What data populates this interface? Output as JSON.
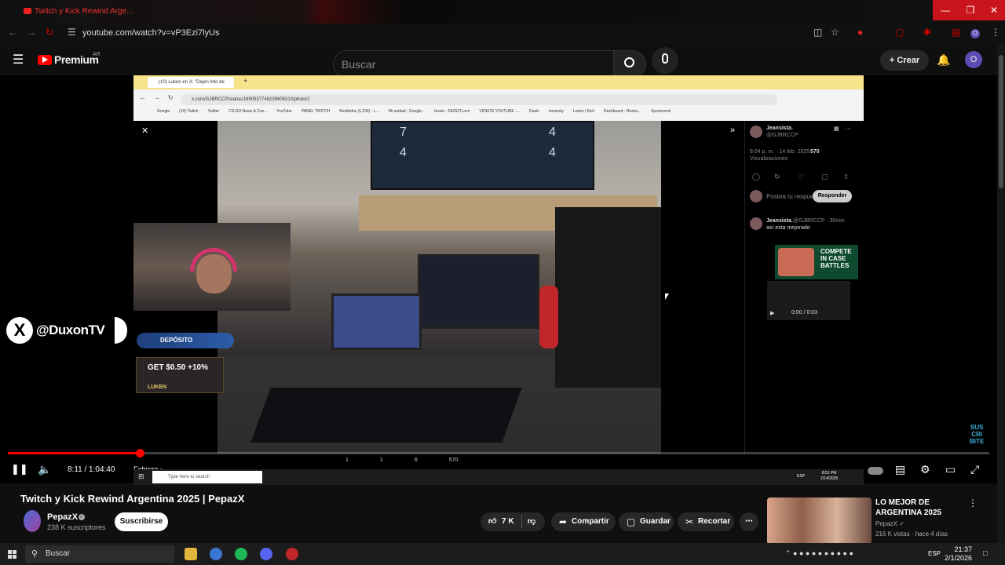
{
  "browser": {
    "tab_title": "Twitch y Kick Rewind Arge...",
    "url": "youtube.com/watch?v=vP3Ezi7lyUs",
    "accent_color": "#c8141a"
  },
  "youtube_header": {
    "logo_text": "Premium",
    "region": "AR",
    "search_placeholder": "Buscar",
    "create_label": "Crear",
    "avatar_letter": "O"
  },
  "video": {
    "inner_browser": {
      "tab_title": "(10) Luken en X: \"Dejen foto de",
      "url": "x.com/GJBRCCP/status/1890537746235605310/photo/1",
      "bookmarks": [
        "Google",
        "(10) Twitch",
        "Twitter",
        "CS:GO News & Cov...",
        "YouTube",
        "PANEL TWITCH",
        "Recibidos (1,234) - L...",
        "Mi unidad - Google...",
        "levels - FACEIT.com",
        "VIDEOS YOUTUBE -...",
        "Deals",
        "invoicely",
        "Luken | Kick",
        "Dashboard - Restre...",
        "Sponsormii"
      ]
    },
    "tv_numbers": [
      "7",
      "4",
      "4",
      "4"
    ],
    "side_panel": {
      "author": "Jeansista.",
      "handle": "@GJBRCCP",
      "timestamp": "8:04 p. m. · 14 feb. 2025 ·",
      "views_count": "570",
      "views_label": "Visualizaciones",
      "reply_placeholder": "Postea tu respuesta",
      "reply_button": "Responder",
      "reply_author": "Jeansista.",
      "reply_meta": "@GJBRCCP · 30min",
      "reply_text": "así esta mejorado",
      "ad_text": "COMPETE IN CASE BATTLES",
      "video_time": "0:00 / 0:03"
    },
    "overlays": {
      "x_handle": "@DuxonTV",
      "deposit_label": "DEPÓSITO",
      "promo_amount": "GET $0.50 +10%",
      "promo_brand": "LUKEN",
      "subscribe_corner": [
        "SUS",
        "CRI",
        "BITE"
      ]
    },
    "player": {
      "current_time": "8:11",
      "duration": "1:04:40",
      "time_text": "8:11 / 1:04:40",
      "chapter": "Febrero",
      "progress_fraction": 0.134,
      "stats": [
        "1",
        "1",
        "6",
        "570"
      ]
    },
    "inner_taskbar": {
      "search_placeholder": "Type here to search",
      "lang": "ESP",
      "time": "8:51 PM",
      "date": "2/14/2025"
    }
  },
  "meta": {
    "title": "Twitch y Kick Rewind Argentina 2025 | PepazX",
    "channel": "PepazX",
    "subscribers": "238 K suscriptores",
    "subscribe_label": "Suscribirse",
    "likes": "7 K",
    "share_label": "Compartir",
    "save_label": "Guardar",
    "clip_label": "Recortar"
  },
  "recommendation": {
    "title": "LO MEJOR DE ARGENTINA 2025",
    "channel": "PepazX",
    "meta": "216 K vistas · hace 4 días"
  },
  "taskbar": {
    "search_placeholder": "Buscar",
    "lang": "ESP",
    "time": "21:37",
    "date": "2/1/2026"
  }
}
